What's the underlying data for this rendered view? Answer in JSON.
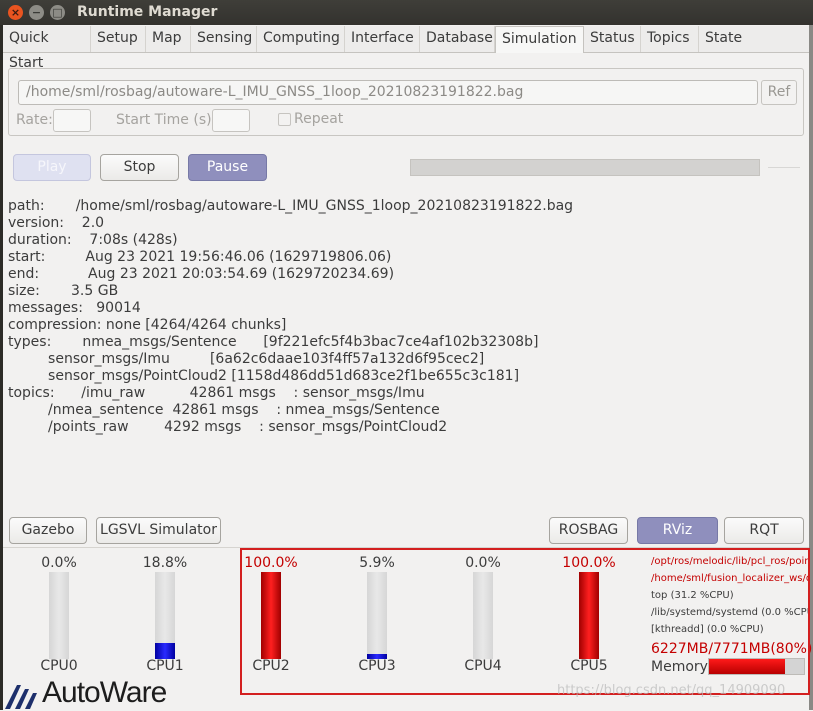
{
  "window": {
    "title": "Runtime Manager",
    "close_glyph": "×",
    "minimize_glyph": "−",
    "maximize_glyph": "□"
  },
  "tabs": [
    {
      "label": "Quick Start"
    },
    {
      "label": "Setup"
    },
    {
      "label": "Map"
    },
    {
      "label": "Sensing"
    },
    {
      "label": "Computing"
    },
    {
      "label": "Interface"
    },
    {
      "label": "Database"
    },
    {
      "label": "Simulation",
      "active": true
    },
    {
      "label": "Status"
    },
    {
      "label": "Topics"
    },
    {
      "label": "State"
    }
  ],
  "simulation": {
    "bag_path": "/home/sml/rosbag/autoware-L_IMU_GNSS_1loop_20210823191822.bag",
    "ref_label": "Ref",
    "rate_label": "Rate:",
    "rate_value": "",
    "start_time_label": "Start Time (s):",
    "start_time_value": "",
    "repeat_label": "Repeat",
    "repeat_checked": false,
    "play_label": "Play",
    "stop_label": "Stop",
    "pause_label": "Pause"
  },
  "bag_info": [
    "path:       /home/sml/rosbag/autoware-L_IMU_GNSS_1loop_20210823191822.bag",
    "version:    2.0",
    "duration:    7:08s (428s)",
    "start:         Aug 23 2021 19:56:46.06 (1629719806.06)",
    "end:           Aug 23 2021 20:03:54.69 (1629720234.69)",
    "size:       3.5 GB",
    "messages:   90014",
    "compression: none [4264/4264 chunks]",
    "types:       nmea_msgs/Sentence      [9f221efc5f4b3bac7ce4af102b32308b]",
    "         sensor_msgs/Imu         [6a62c6daae103f4ff57a132d6f95cec2]",
    "         sensor_msgs/PointCloud2 [1158d486dd51d683ce2f1be655c3c181]",
    "topics:      /imu_raw          42861 msgs    : sensor_msgs/Imu",
    "         /nmea_sentence  42861 msgs    : nmea_msgs/Sentence",
    "         /points_raw        4292 msgs    : sensor_msgs/PointCloud2"
  ],
  "tools": {
    "gazebo": "Gazebo",
    "lgsvl": "LGSVL Simulator",
    "rosbag": "ROSBAG",
    "rviz": "RViz",
    "rqt": "RQT"
  },
  "cpus": [
    {
      "name": "CPU0",
      "percent_label": "0.0%",
      "value": 0.0,
      "color": "#1a1ad0"
    },
    {
      "name": "CPU1",
      "percent_label": "18.8%",
      "value": 18.8,
      "color": "#1a1ad0"
    },
    {
      "name": "CPU2",
      "percent_label": "100.0%",
      "value": 100.0,
      "color": "#d00000"
    },
    {
      "name": "CPU3",
      "percent_label": "5.9%",
      "value": 5.9,
      "color": "#1a1ad0"
    },
    {
      "name": "CPU4",
      "percent_label": "0.0%",
      "value": 0.0,
      "color": "#1a1ad0"
    },
    {
      "name": "CPU5",
      "percent_label": "100.0%",
      "value": 100.0,
      "color": "#d00000"
    }
  ],
  "processes": [
    {
      "text": "/opt/ros/melodic/lib/pcl_ros/poin",
      "color": "#c40000"
    },
    {
      "text": "/home/sml/fusion_localizer_ws/d",
      "color": "#c40000"
    },
    {
      "text": "top (31.2 %CPU)",
      "color": "#3c3c3c"
    },
    {
      "text": "/lib/systemd/systemd (0.0 %CPU",
      "color": "#3c3c3c"
    },
    {
      "text": "[kthreadd] (0.0 %CPU)",
      "color": "#3c3c3c"
    }
  ],
  "memory": {
    "text": "6227MB/7771MB(80%)",
    "label": "Memory",
    "percent": 80
  },
  "logo_text": "AutoWare",
  "watermark": "https://blog.csdn.net/qq_14909090"
}
